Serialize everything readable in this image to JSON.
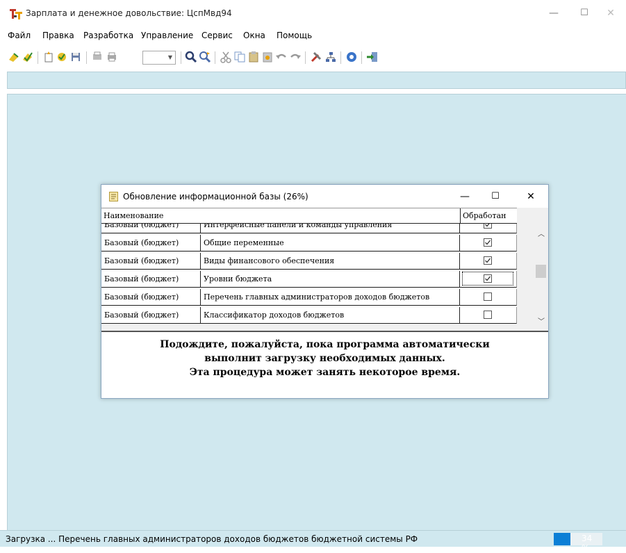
{
  "window": {
    "title": "Зарплата и денежное довольствие: ЦспМвд94",
    "minimize": "—",
    "maximize": "☐",
    "close": "✕"
  },
  "menu": [
    "Файл",
    "Правка",
    "Разработка",
    "Управление",
    "Сервис",
    "Окна",
    "Помощь"
  ],
  "toolbar": {
    "icons": [
      "open-icon",
      "save-icon",
      "new-icon",
      "properties-icon",
      "floppy-icon",
      "preview-icon",
      "print-icon",
      "find-icon",
      "find-next-icon",
      "cut-icon",
      "copy-icon",
      "paste-icon",
      "paste-special-icon",
      "undo-icon",
      "redo-icon",
      "tools-icon",
      "tree-icon",
      "help-icon",
      "exit-icon"
    ],
    "combo_value": ""
  },
  "dialog": {
    "title": "Обновление информационной базы (26%)",
    "minimize": "—",
    "maximize": "☐",
    "close": "✕",
    "columns": {
      "name": "Наименование",
      "processed": "Обработан"
    },
    "rows": [
      {
        "config": "Базовый (бюджет)",
        "object": "Интерфейсные панели и команды управления",
        "processed": true
      },
      {
        "config": "Базовый (бюджет)",
        "object": "Общие переменные",
        "processed": true
      },
      {
        "config": "Базовый (бюджет)",
        "object": "Виды финансового обеспечения",
        "processed": true
      },
      {
        "config": "Базовый (бюджет)",
        "object": "Уровни бюджета",
        "processed": true
      },
      {
        "config": "Базовый (бюджет)",
        "object": "Перечень главных администраторов доходов бюджетов",
        "processed": false
      },
      {
        "config": "Базовый (бюджет)",
        "object": "Классификатор доходов бюджетов",
        "processed": false
      }
    ],
    "message": [
      "Подождите, пожалуйста, пока программа автоматически",
      "выполнит загрузку необходимых данных.",
      "Эта процедура может занять некоторое время."
    ]
  },
  "status": {
    "text": "Загрузка ... Перечень главных администраторов доходов бюджетов бюджетной системы РФ",
    "progress_label": "34 %",
    "progress_value": 0.34,
    "progress_color": "#0b7fd6"
  },
  "colors": {
    "workspace": "#d0e8ef",
    "window_bg": "#ffffff"
  }
}
